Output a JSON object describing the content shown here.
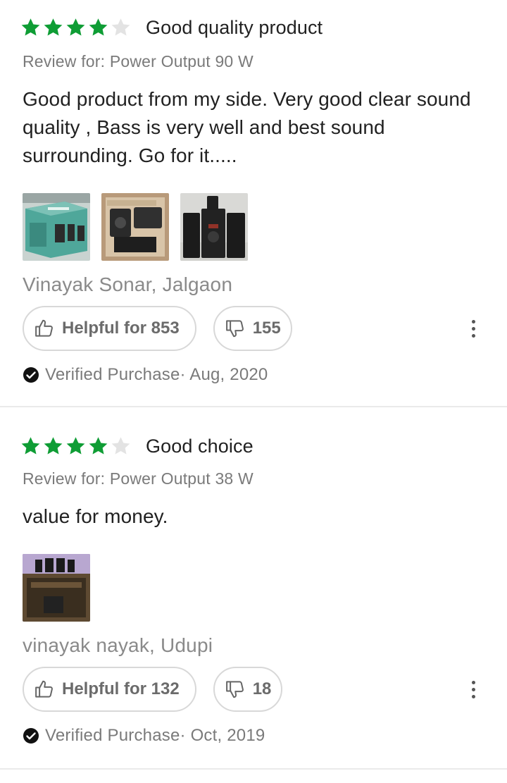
{
  "colors": {
    "star_filled": "#0f9d35",
    "star_empty": "#e3e3e3",
    "border": "#d8d8d8"
  },
  "reviews": [
    {
      "rating": 4,
      "rating_max": 5,
      "title": "Good quality product",
      "review_for": "Review for: Power Output 90 W",
      "text": "Good product from my side. Very good clear sound quality , Bass is very well and best sound surrounding. Go for it.....",
      "photo_icons": [
        "product-box-photo",
        "unboxed-speakers-photo",
        "speaker-set-photo"
      ],
      "author": "Vinayak Sonar, Jalgaon",
      "helpful_label": "Helpful for 853",
      "dislike_count": "155",
      "verified": "Verified Purchase· Aug, 2020"
    },
    {
      "rating": 4,
      "rating_max": 5,
      "title": "Good choice",
      "review_for": "Review for: Power Output 38 W",
      "text": "value for money.",
      "photo_icons": [
        "installed-speakers-photo"
      ],
      "author": "vinayak nayak, Udupi",
      "helpful_label": "Helpful for 132",
      "dislike_count": "18",
      "verified": "Verified Purchase· Oct, 2019"
    }
  ]
}
